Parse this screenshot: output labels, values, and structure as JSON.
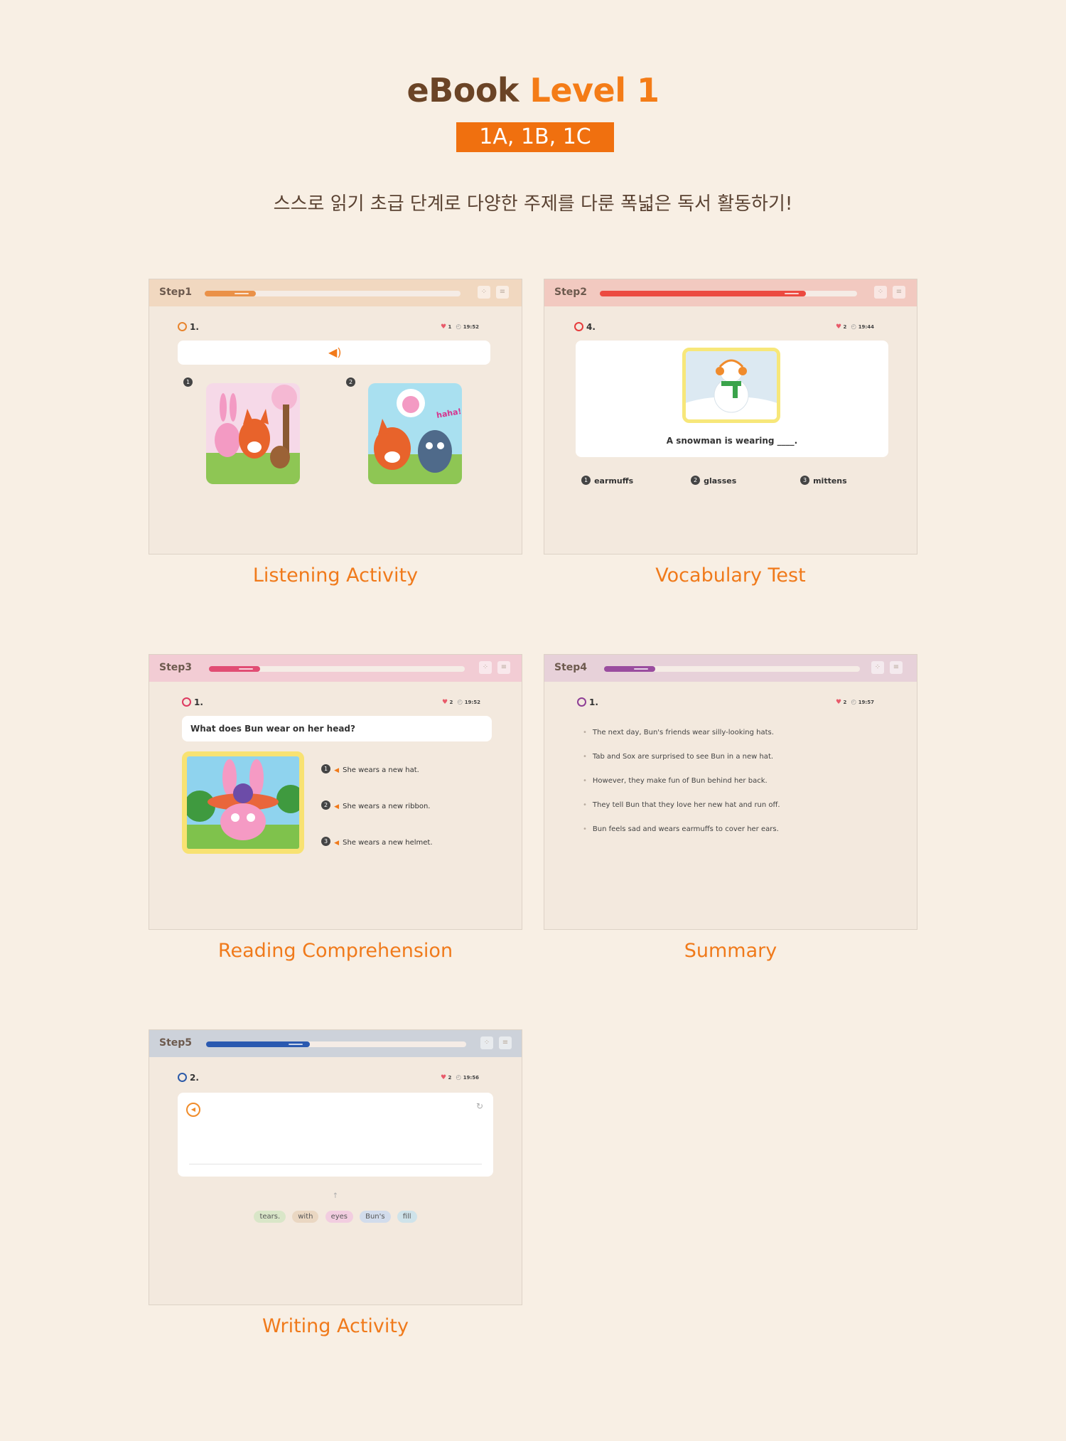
{
  "header": {
    "title_prefix": "eBook",
    "title_level": "Level 1",
    "badge": "1A, 1B, 1C",
    "subtitle": "스스로 읽기 초급 단계로 다양한 주제를 다룬 폭넓은 독서 활동하기!"
  },
  "colors": {
    "accent": "#f47c17",
    "step1": "#f0a15b",
    "step2": "#ec5a4f",
    "step3": "#e4577a",
    "step4": "#9b5ba5",
    "step5": "#2f5eb0"
  },
  "panels": {
    "step1": {
      "step_label": "Step1",
      "progress": 0.2,
      "question": "1.",
      "hearts": "1",
      "time": "19:52",
      "options": [
        "1",
        "2"
      ],
      "speech": "haha!",
      "caption": "Listening Activity"
    },
    "step2": {
      "step_label": "Step2",
      "progress": 0.85,
      "question": "4.",
      "hearts": "2",
      "time": "19:44",
      "sentence": "A snowman is wearing ____.",
      "options": [
        "earmuffs",
        "glasses",
        "mittens"
      ],
      "caption": "Vocabulary Test"
    },
    "step3": {
      "step_label": "Step3",
      "progress": 0.2,
      "question": "1.",
      "hearts": "2",
      "time": "19:52",
      "prompt": "What does Bun wear on her head?",
      "options": [
        "She wears a new hat.",
        "She wears a new ribbon.",
        "She wears a new helmet."
      ],
      "caption": "Reading Comprehension"
    },
    "step4": {
      "step_label": "Step4",
      "progress": 0.2,
      "question": "1.",
      "hearts": "2",
      "time": "19:57",
      "lines": [
        "The next day, Bun's friends wear silly-looking hats.",
        "Tab and Sox are surprised to see Bun in a new hat.",
        "However, they make fun of Bun behind her back.",
        "They tell Bun that they love her new hat and run off.",
        "Bun feels sad and wears earmuffs to cover her ears."
      ],
      "caption": "Summary"
    },
    "step5": {
      "step_label": "Step5",
      "progress": 0.4,
      "question": "2.",
      "hearts": "2",
      "time": "19:56",
      "words": [
        "tears.",
        "with",
        "eyes",
        "Bun's",
        "fill"
      ],
      "caption": "Writing Activity"
    }
  }
}
